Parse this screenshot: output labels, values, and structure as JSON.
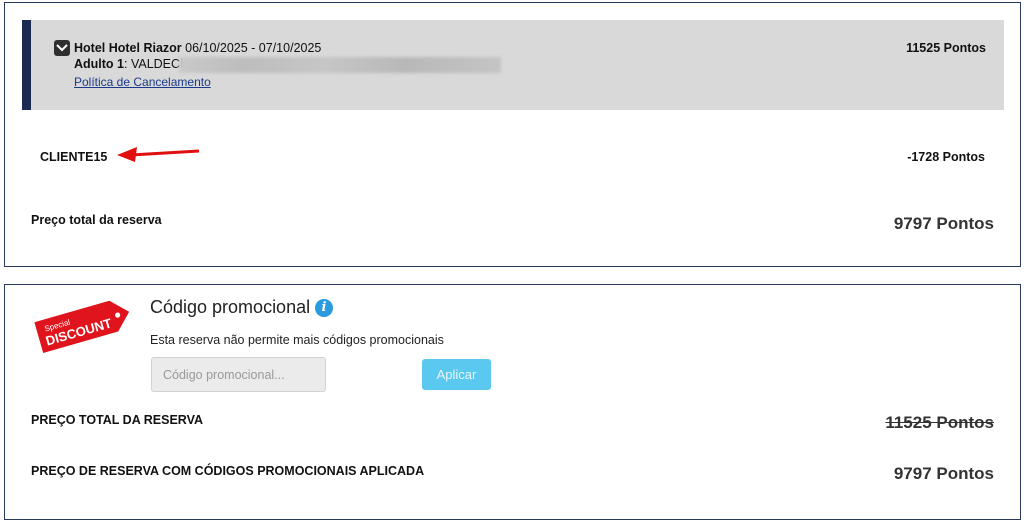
{
  "reservation": {
    "hotel_label": "Hotel Hotel Riazor",
    "dates": "06/10/2025 - 07/10/2025",
    "adult_label": "Adulto 1",
    "adult_name": "VALDECI",
    "cancel_link": "Política de Cancelamento",
    "hotel_points": "11525 Pontos"
  },
  "coupon": {
    "code": "CLIENTE15",
    "points": "-1728 Pontos"
  },
  "total": {
    "label": "Preço total da reserva",
    "value": "9797 Pontos"
  },
  "promo": {
    "tag_small": "Special",
    "tag_big": "DISCOUNT",
    "title": "Código promocional",
    "info_icon": "i",
    "message": "Esta reserva não permite mais códigos promocionais",
    "input_placeholder": "Código promocional...",
    "apply_label": "Aplicar",
    "total_caps_label": "PREÇO TOTAL DA RESERVA",
    "total_caps_value": "11525 Pontos",
    "final_label": "PREÇO DE RESERVA COM CÓDIGOS PROMOCIONAIS APLICADA",
    "final_value": "9797 Pontos"
  },
  "colors": {
    "accent_bar": "#1a2a52",
    "apply_button": "#5bc8ef",
    "tag_red": "#e0141c",
    "arrow_red": "#e01010",
    "info_blue": "#2b9be0"
  },
  "icons": {
    "toggle": "chevron-down-icon",
    "arrow": "red-arrow-icon",
    "info": "info-icon",
    "tag": "discount-tag-icon"
  }
}
